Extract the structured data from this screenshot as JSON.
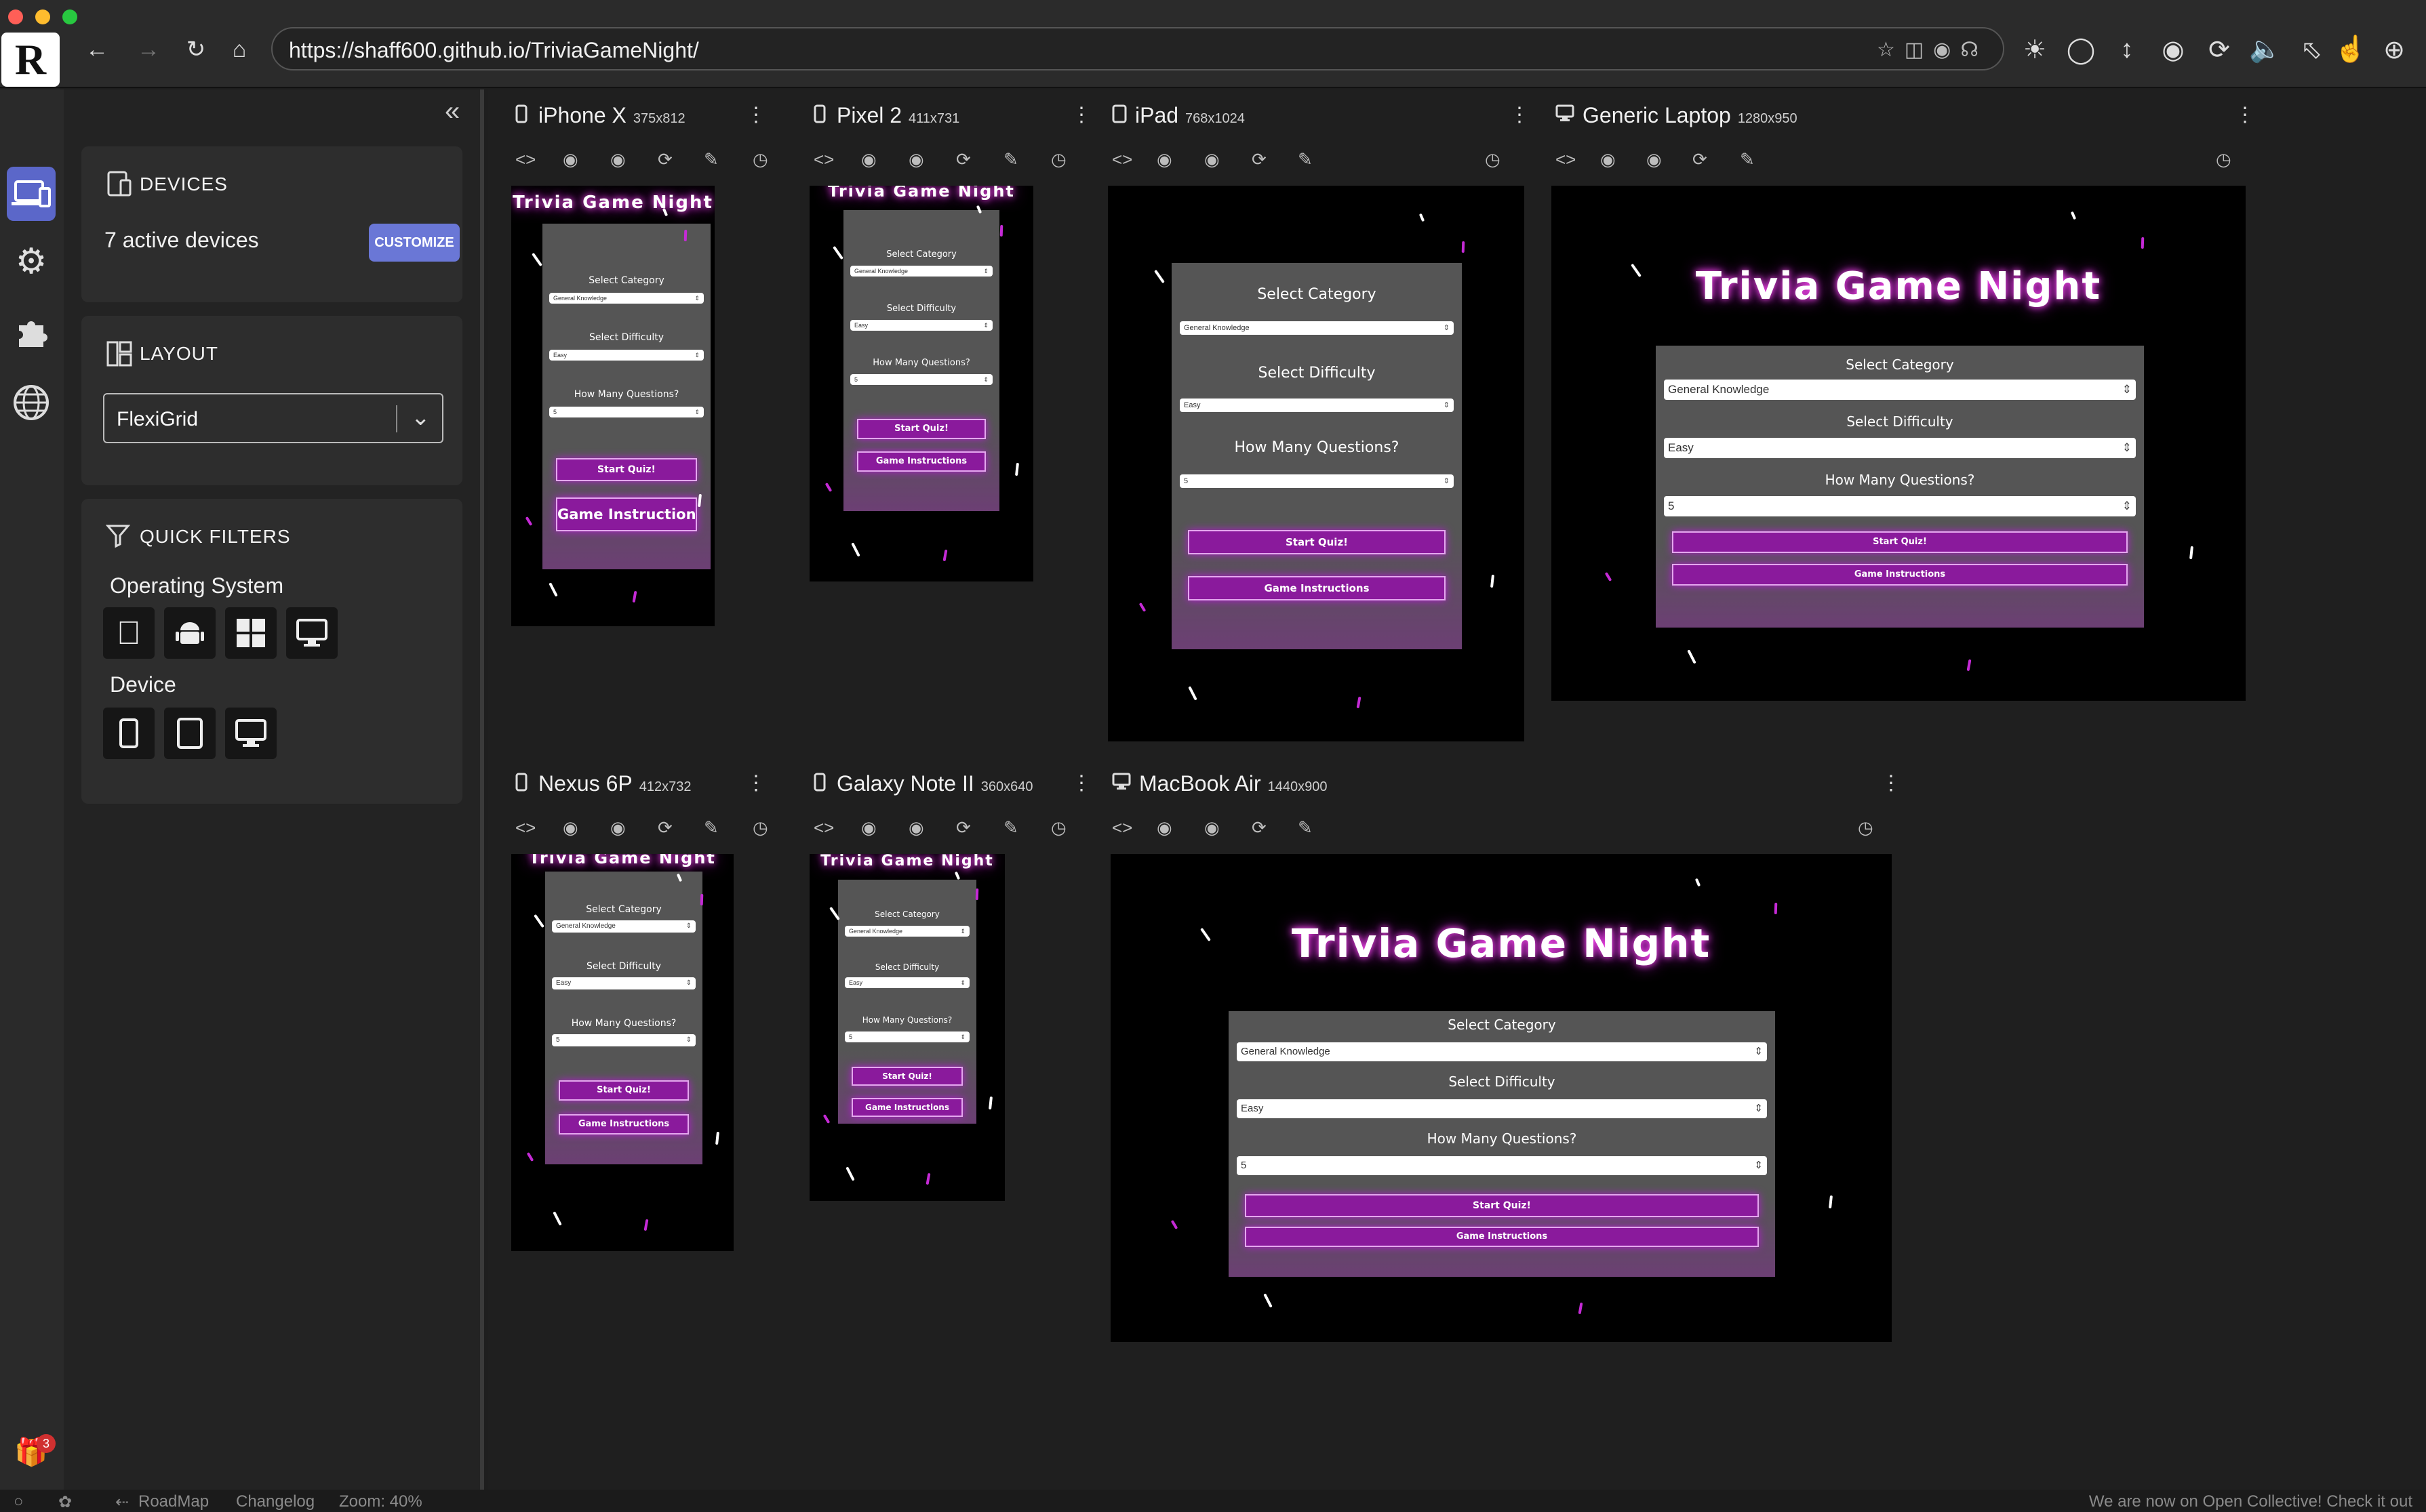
{
  "browser": {
    "url": "https://shaff600.github.io/TriviaGameNight/",
    "logo": "R"
  },
  "sidebar": {
    "devices_title": "DEVICES",
    "active_devices": "7 active devices",
    "customize_label": "CUSTOMIZE",
    "layout_title": "LAYOUT",
    "layout_value": "FlexiGrid",
    "quick_filters_title": "QUICK FILTERS",
    "os_label": "Operating System",
    "device_label": "Device",
    "gift_badge": "3"
  },
  "statusbar": {
    "roadmap": "RoadMap",
    "changelog": "Changelog",
    "zoom": "Zoom: 40%",
    "notice": "We are now on Open Collective! Check it out"
  },
  "app": {
    "title": "Trivia Game Night",
    "select_category": "Select Category",
    "category_value": "General Knowledge",
    "select_difficulty": "Select Difficulty",
    "difficulty_value": "Easy",
    "how_many": "How Many Questions?",
    "count_value": "5",
    "start_quiz": "Start Quiz!",
    "instructions": "Game Instructions"
  },
  "devices": [
    {
      "name": "iPhone X",
      "res": "375x812"
    },
    {
      "name": "Pixel 2",
      "res": "411x731"
    },
    {
      "name": "iPad",
      "res": "768x1024"
    },
    {
      "name": "Generic Laptop",
      "res": "1280x950"
    },
    {
      "name": "Nexus 6P",
      "res": "412x732"
    },
    {
      "name": "Galaxy Note II",
      "res": "360x640"
    },
    {
      "name": "MacBook Air",
      "res": "1440x900"
    }
  ],
  "colors": {
    "accent": "#6a77d6",
    "button_purple": "#8a1a9c",
    "glow": "#ff4df5"
  }
}
